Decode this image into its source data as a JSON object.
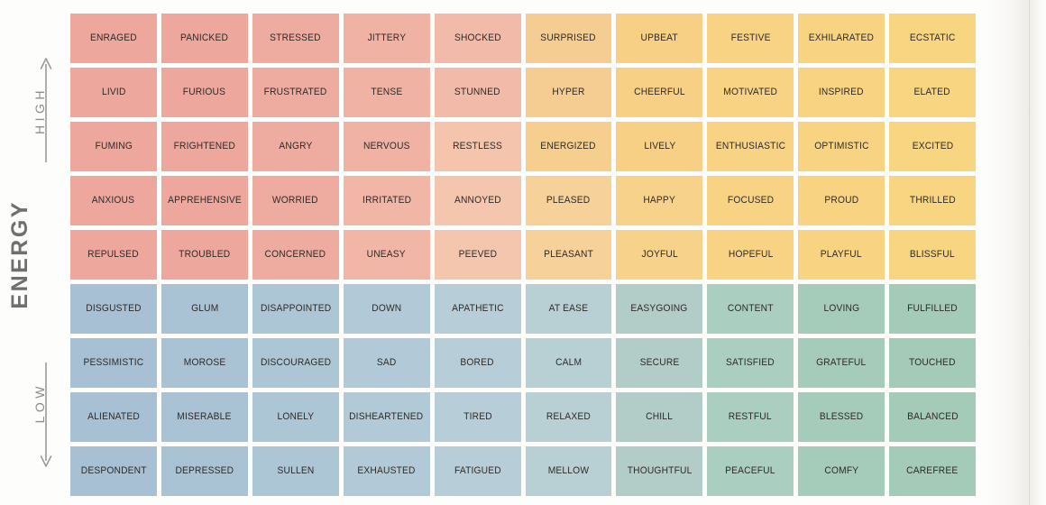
{
  "axis": {
    "title": "ENERGY",
    "high_label": "HIGH",
    "low_label": "LOW",
    "arrow_up": "arrow-up-icon",
    "arrow_down": "arrow-down-icon"
  },
  "colors": {
    "red_quadrant": "#eda79d",
    "yellow_quadrant": "#f7d382",
    "blue_quadrant": "#a7c0d3",
    "green_quadrant": "#a3cbb8",
    "text": "#2f2a27",
    "axis_text": "#6f6f6f",
    "page_background": "#fdfdfc"
  },
  "grid": {
    "columns": 10,
    "rows": 9,
    "cells": [
      [
        {
          "label": "ENRAGED",
          "color": "#eda79d"
        },
        {
          "label": "PANICKED",
          "color": "#eda79d"
        },
        {
          "label": "STRESSED",
          "color": "#eeab9f"
        },
        {
          "label": "JITTERY",
          "color": "#f0b2a3"
        },
        {
          "label": "SHOCKED",
          "color": "#f2bba9"
        },
        {
          "label": "SURPRISED",
          "color": "#f5cd93"
        },
        {
          "label": "UPBEAT",
          "color": "#f7d086"
        },
        {
          "label": "FESTIVE",
          "color": "#f8d384"
        },
        {
          "label": "EXHILARATED",
          "color": "#f8d482"
        },
        {
          "label": "ECSTATIC",
          "color": "#f8d581"
        }
      ],
      [
        {
          "label": "LIVID",
          "color": "#eda79d"
        },
        {
          "label": "FURIOUS",
          "color": "#eda79d"
        },
        {
          "label": "FRUSTRATED",
          "color": "#eeab9f"
        },
        {
          "label": "TENSE",
          "color": "#f0b2a3"
        },
        {
          "label": "STUNNED",
          "color": "#f2bba9"
        },
        {
          "label": "HYPER",
          "color": "#f5cd93"
        },
        {
          "label": "CHEERFUL",
          "color": "#f7d086"
        },
        {
          "label": "MOTIVATED",
          "color": "#f8d384"
        },
        {
          "label": "INSPIRED",
          "color": "#f8d482"
        },
        {
          "label": "ELATED",
          "color": "#f8d581"
        }
      ],
      [
        {
          "label": "FUMING",
          "color": "#eda79d"
        },
        {
          "label": "FRIGHTENED",
          "color": "#eda79d"
        },
        {
          "label": "ANGRY",
          "color": "#eeab9f"
        },
        {
          "label": "NERVOUS",
          "color": "#f0b2a3"
        },
        {
          "label": "RESTLESS",
          "color": "#f4c4ad"
        },
        {
          "label": "ENERGIZED",
          "color": "#f6cf8f"
        },
        {
          "label": "LIVELY",
          "color": "#f7d086"
        },
        {
          "label": "ENTHUSIASTIC",
          "color": "#f8d384"
        },
        {
          "label": "OPTIMISTIC",
          "color": "#f8d482"
        },
        {
          "label": "EXCITED",
          "color": "#f8d581"
        }
      ],
      [
        {
          "label": "ANXIOUS",
          "color": "#eda79d"
        },
        {
          "label": "APPREHENSIVE",
          "color": "#eda79d"
        },
        {
          "label": "WORRIED",
          "color": "#eeab9f"
        },
        {
          "label": "IRRITATED",
          "color": "#f1b6a6"
        },
        {
          "label": "ANNOYED",
          "color": "#f4c6ae"
        },
        {
          "label": "PLEASED",
          "color": "#f6d199"
        },
        {
          "label": "HAPPY",
          "color": "#f7d28a"
        },
        {
          "label": "FOCUSED",
          "color": "#f8d384"
        },
        {
          "label": "PROUD",
          "color": "#f8d482"
        },
        {
          "label": "THRILLED",
          "color": "#f8d581"
        }
      ],
      [
        {
          "label": "REPULSED",
          "color": "#eda79d"
        },
        {
          "label": "TROUBLED",
          "color": "#eda79d"
        },
        {
          "label": "CONCERNED",
          "color": "#eeab9f"
        },
        {
          "label": "UNEASY",
          "color": "#f1b6a6"
        },
        {
          "label": "PEEVED",
          "color": "#f4c6ae"
        },
        {
          "label": "PLEASANT",
          "color": "#f6d199"
        },
        {
          "label": "JOYFUL",
          "color": "#f7d28a"
        },
        {
          "label": "HOPEFUL",
          "color": "#f8d384"
        },
        {
          "label": "PLAYFUL",
          "color": "#f8d482"
        },
        {
          "label": "BLISSFUL",
          "color": "#f8d581"
        }
      ],
      [
        {
          "label": "DISGUSTED",
          "color": "#a7c0d3"
        },
        {
          "label": "GLUM",
          "color": "#a9c2d4"
        },
        {
          "label": "DISAPPOINTED",
          "color": "#adc6d5"
        },
        {
          "label": "DOWN",
          "color": "#b2cad7"
        },
        {
          "label": "APATHETIC",
          "color": "#b7ced9"
        },
        {
          "label": "AT EASE",
          "color": "#b8d0d3"
        },
        {
          "label": "EASYGOING",
          "color": "#b2ccc7"
        },
        {
          "label": "CONTENT",
          "color": "#aacec0"
        },
        {
          "label": "LOVING",
          "color": "#a5cbba"
        },
        {
          "label": "FULFILLED",
          "color": "#a3cbb8"
        }
      ],
      [
        {
          "label": "PESSIMISTIC",
          "color": "#a7c0d3"
        },
        {
          "label": "MOROSE",
          "color": "#a9c2d4"
        },
        {
          "label": "DISCOURAGED",
          "color": "#adc6d5"
        },
        {
          "label": "SAD",
          "color": "#b2cad7"
        },
        {
          "label": "BORED",
          "color": "#b7ced9"
        },
        {
          "label": "CALM",
          "color": "#b8d0d3"
        },
        {
          "label": "SECURE",
          "color": "#b2ccc7"
        },
        {
          "label": "SATISFIED",
          "color": "#aacec0"
        },
        {
          "label": "GRATEFUL",
          "color": "#a5cbba"
        },
        {
          "label": "TOUCHED",
          "color": "#a3cbb8"
        }
      ],
      [
        {
          "label": "ALIENATED",
          "color": "#a7c0d3"
        },
        {
          "label": "MISERABLE",
          "color": "#a9c2d4"
        },
        {
          "label": "LONELY",
          "color": "#adc6d5"
        },
        {
          "label": "DISHEARTENED",
          "color": "#b2cad7"
        },
        {
          "label": "TIRED",
          "color": "#b7ced9"
        },
        {
          "label": "RELAXED",
          "color": "#b8d0d3"
        },
        {
          "label": "CHILL",
          "color": "#b2ccc7"
        },
        {
          "label": "RESTFUL",
          "color": "#aacec0"
        },
        {
          "label": "BLESSED",
          "color": "#a5cbba"
        },
        {
          "label": "BALANCED",
          "color": "#a3cbb8"
        }
      ],
      [
        {
          "label": "DESPONDENT",
          "color": "#a7c0d3"
        },
        {
          "label": "DEPRESSED",
          "color": "#a9c2d4"
        },
        {
          "label": "SULLEN",
          "color": "#adc6d5"
        },
        {
          "label": "EXHAUSTED",
          "color": "#b2cad7"
        },
        {
          "label": "FATIGUED",
          "color": "#b7ced9"
        },
        {
          "label": "MELLOW",
          "color": "#b8d0d3"
        },
        {
          "label": "THOUGHTFUL",
          "color": "#b2ccc7"
        },
        {
          "label": "PEACEFUL",
          "color": "#aacec0"
        },
        {
          "label": "COMFY",
          "color": "#a5cbba"
        },
        {
          "label": "CAREFREE",
          "color": "#a3cbb8"
        }
      ]
    ]
  }
}
